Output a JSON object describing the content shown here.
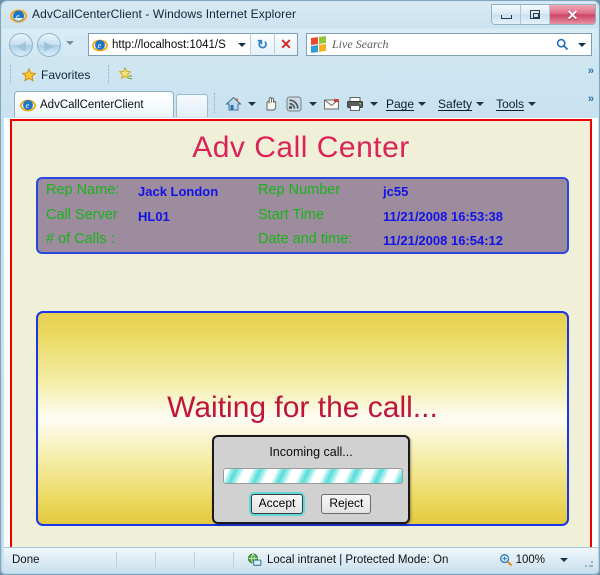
{
  "browser": {
    "title": "AdvCallCenterClient - Windows Internet Explorer",
    "window_controls": {
      "minimize": "minimize-button",
      "maximize": "maximize-button",
      "close": "✕"
    },
    "address": {
      "url": "http://localhost:1041/S",
      "refresh_glyph": "↻",
      "stop_glyph": "✕"
    },
    "search": {
      "placeholder": "Live Search",
      "go_glyph": "⌕"
    },
    "favorites": {
      "label": "Favorites",
      "add_icon": "add-favorite-icon",
      "overflow": "»"
    },
    "tabs": [
      {
        "label": "AdvCallCenterClient"
      }
    ],
    "new_tab_label": "",
    "command_bar": {
      "icons": [
        "home-icon",
        "read-mail-icon",
        "feeds-icon",
        "mail-icon",
        "print-icon"
      ],
      "menus": [
        "Page",
        "Safety",
        "Tools"
      ],
      "overflow": "»"
    },
    "status": {
      "text": "Done",
      "zone": "Local intranet | Protected Mode: On",
      "zoom": "100%"
    }
  },
  "page": {
    "title": "Adv Call Center",
    "info_panel": {
      "rows": [
        {
          "left_label": "Rep Name:",
          "left_value": "Jack London",
          "right_label": "Rep Number",
          "right_value": "jc55"
        },
        {
          "left_label": "Call Server",
          "left_value": "HL01",
          "right_label": "Start Time",
          "right_value": "11/21/2008 16:53:38"
        },
        {
          "left_label": "# of Calls :",
          "left_value": "",
          "right_label": "Date and time:",
          "right_value": "11/21/2008 16:54:12"
        }
      ]
    },
    "call_panel": {
      "waiting_text": "Waiting for the call..."
    },
    "dialog": {
      "title": "Incoming call...",
      "progress_indeterminate": true,
      "accept_label": "Accept",
      "reject_label": "Reject"
    }
  },
  "colors": {
    "page_title": "#dc2358",
    "waiting_text": "#c0143c",
    "page_border": "#ee0000",
    "page_background": "#f0f0d8",
    "info_panel_bg": "#9d8c9d",
    "info_label": "#19b319",
    "info_value": "#1212e8",
    "panel_border": "#1a36e8",
    "progress_stripe": "#55dddb",
    "focus_ring": "#5fd8d8"
  }
}
